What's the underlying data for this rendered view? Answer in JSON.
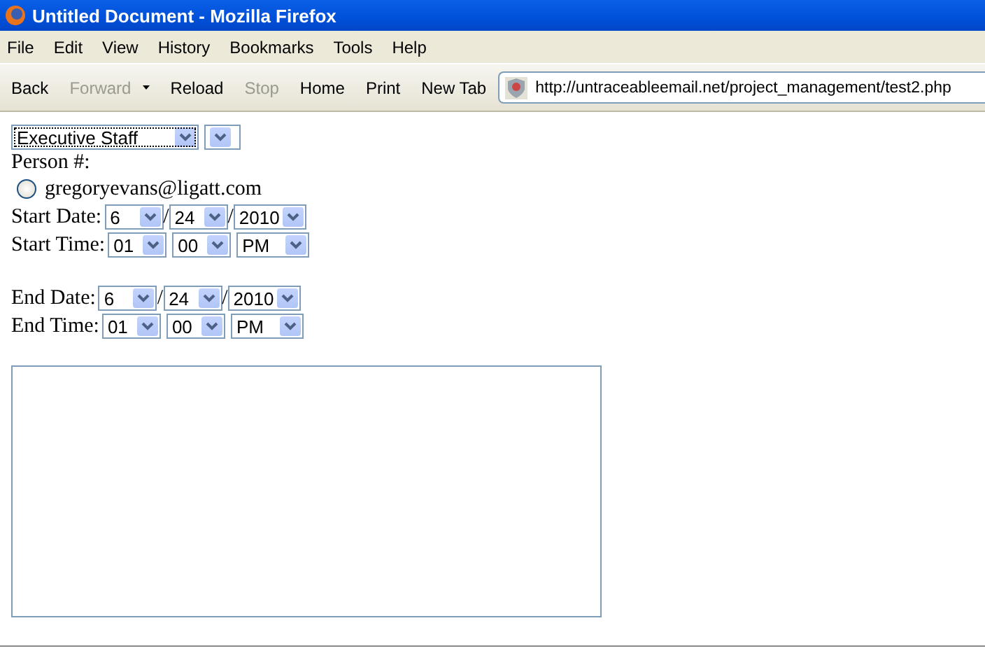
{
  "window": {
    "title": "Untitled Document - Mozilla Firefox"
  },
  "menu": [
    "File",
    "Edit",
    "View",
    "History",
    "Bookmarks",
    "Tools",
    "Help"
  ],
  "toolbar": [
    {
      "label": "Back",
      "disabled": false
    },
    {
      "label": "Forward",
      "disabled": true
    },
    {
      "label": "Reload",
      "disabled": false
    },
    {
      "label": "Stop",
      "disabled": true
    },
    {
      "label": "Home",
      "disabled": false
    },
    {
      "label": "Print",
      "disabled": false
    },
    {
      "label": "New Tab",
      "disabled": false
    }
  ],
  "address": {
    "value": "http://untraceableemail.net/project_management/test2.php"
  },
  "form": {
    "top_selects": [
      {
        "value": "Executive Staff",
        "focused": true
      },
      {
        "focused": false
      }
    ],
    "person_label": "Person #:",
    "persons": [
      {
        "label": "gregoryevans@ligatt.com",
        "selected": false
      }
    ],
    "groups": [
      [
        {
          "label": "Start Date:",
          "sep": "/",
          "fields": [
            "6",
            "24",
            "2010"
          ]
        },
        {
          "label": "Start Time:",
          "fields": [
            "01",
            "00",
            "PM"
          ]
        }
      ],
      [
        {
          "label": "End Date:",
          "sep": "/",
          "fields": [
            "6",
            "24",
            "2010"
          ]
        },
        {
          "label": "End Time:",
          "fields": [
            "01",
            "00",
            "PM"
          ]
        }
      ]
    ]
  }
}
